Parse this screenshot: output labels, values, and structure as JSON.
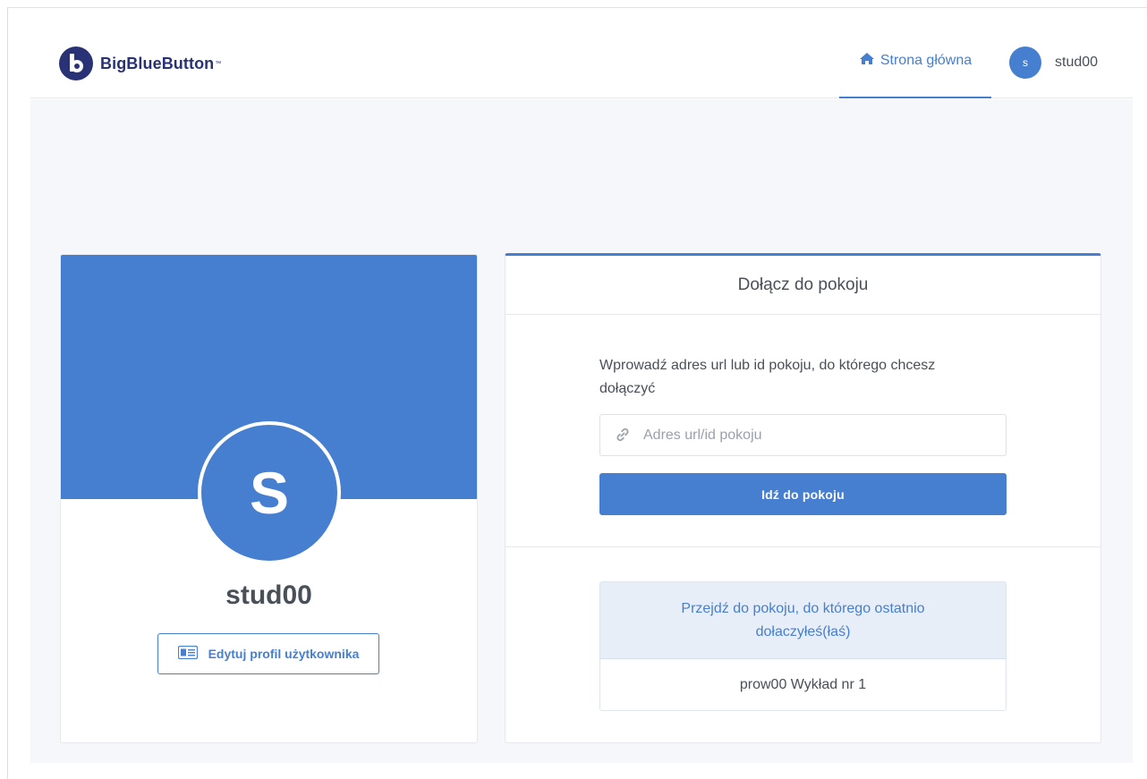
{
  "header": {
    "logo_text": "BigBlueButton",
    "logo_tm": "™",
    "nav_home_label": "Strona główna",
    "user_initial": "s",
    "username": "stud00"
  },
  "profile": {
    "avatar_letter": "S",
    "name": "stud00",
    "edit_button_label": "Edytuj profil użytkownika"
  },
  "join": {
    "title": "Dołącz do pokoju",
    "description": "Wprowadź adres url lub id pokoju, do którego chcesz dołączyć",
    "input_placeholder": "Adres url/id pokoju",
    "input_value": "",
    "go_button_label": "Idź do pokoju",
    "recent_heading": "Przejdź do pokoju, do którego ostatnio dołaczyłeś(łaś)",
    "recent_room": "prow00 Wykład nr 1"
  },
  "colors": {
    "accent": "#467fcf",
    "brand": "#283274",
    "background": "#f5f7fb",
    "text": "#495057"
  },
  "icons": {
    "logo": "bigbluebutton-logo-icon",
    "home": "home-icon",
    "edit_profile": "id-card-icon",
    "url": "link-icon"
  }
}
